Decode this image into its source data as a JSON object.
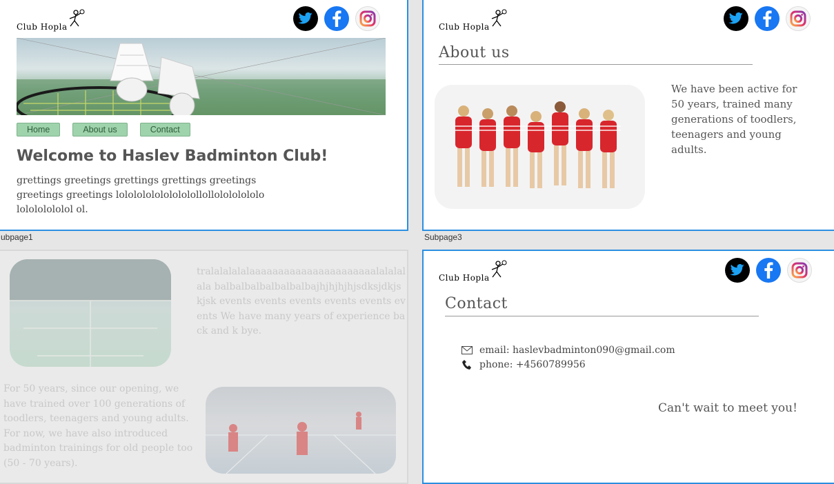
{
  "brand": {
    "logo_text": "Club Hopla"
  },
  "social": {
    "icons": [
      "twitter-icon",
      "facebook-icon",
      "instagram-icon"
    ]
  },
  "subpage1": {
    "label": "ubpage1",
    "nav": [
      "Home",
      "About us",
      "Contact"
    ],
    "welcome": "Welcome to Haslev Badminton Club!",
    "greeting": "grettings greetings grettings grettings greetings greetings greetings lololololololololollollolololololololololololol ol."
  },
  "subpage2": {
    "text_right": "tralalalalalaaaaaaaaaaaaaaaaaaaaaalalalalala balbalbalbalbalbalbajhjhjhjhjsdksjdkjskjsk events events events events events events We have many years of experience back and k bye.",
    "text_left": "For 50 years, since our opening, we have trained over 100 generations of toodlers, teenagers and young adults. For now, we have also introduced badminton trainings for old people too (50 - 70 years)."
  },
  "subpage3": {
    "label": "Subpage3",
    "title": "About us",
    "text": "We have been active for 50 years, trained many generations of toodlers, teenagers and young adults."
  },
  "subpage4": {
    "title": "Contact",
    "email": "email: haslevbadminton090@gmail.com",
    "phone": "phone: +4560789956",
    "meet": "Can't wait to meet you!"
  },
  "colors": {
    "accent_border": "#2b8fe0",
    "nav_button": "#9fd3ac",
    "twitter": "#000000",
    "facebook": "#1877f2"
  }
}
